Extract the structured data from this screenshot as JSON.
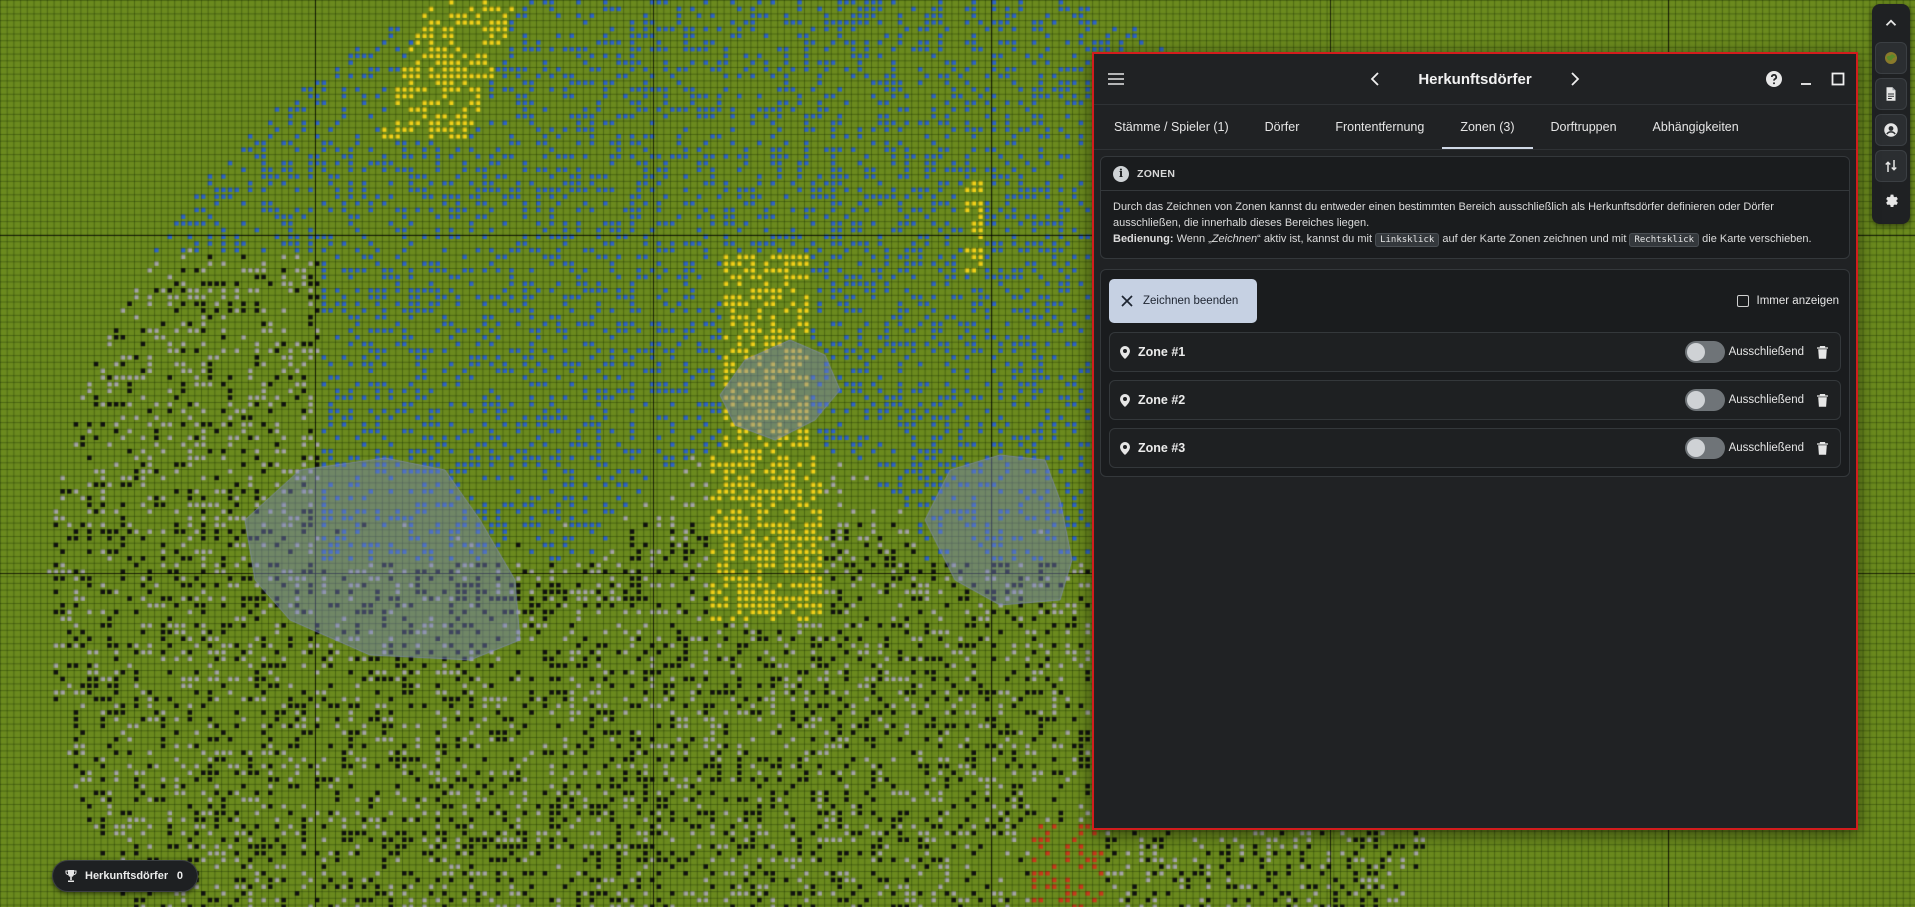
{
  "colors": {
    "map_bg": "#6b8a1e",
    "panel_bg": "#202224",
    "panel_border": "#d21d1d",
    "accent": "#c6d1e3",
    "village_blue": "#2f64c8",
    "village_yellow": "#f2d21a",
    "village_grey": "#a6a6a6",
    "village_black": "#111111",
    "village_red": "#c93a1c"
  },
  "toolbar": {
    "items": [
      {
        "name": "chevron-up-icon"
      },
      {
        "name": "world-map-icon"
      },
      {
        "name": "document-icon"
      },
      {
        "name": "account-icon"
      },
      {
        "name": "route-icon"
      },
      {
        "name": "gear-icon"
      }
    ]
  },
  "panel": {
    "title": "Herkunftsdörfer",
    "tabs": [
      {
        "label": "Stämme / Spieler (1)",
        "active": false
      },
      {
        "label": "Dörfer",
        "active": false
      },
      {
        "label": "Frontentfernung",
        "active": false
      },
      {
        "label": "Zonen (3)",
        "active": true
      },
      {
        "label": "Dorftruppen",
        "active": false
      },
      {
        "label": "Abhängigkeiten",
        "active": false
      }
    ],
    "info": {
      "title": "ZONEN",
      "description": "Durch das Zeichnen von Zonen kannst du entweder einen bestimmten Bereich ausschließlich als Herkunftsdörfer definieren oder Dörfer ausschließen, die innerhalb dieses Bereiches liegen.",
      "usage_label": "Bedienung:",
      "usage_part1": "Wenn „",
      "usage_em": "Zeichnen",
      "usage_part2": "“ aktiv ist, kannst du mit",
      "key_left": "Linksklick",
      "usage_part3": "auf der Karte Zonen zeichnen und mit",
      "key_right": "Rechtsklick",
      "usage_part4": "die Karte verschieben."
    },
    "stop_button": "Zeichnen beenden",
    "always_show": "Immer anzeigen",
    "zones": [
      {
        "name": "Zone #1",
        "exclusive_label": "Ausschließend",
        "exclusive": false
      },
      {
        "name": "Zone #2",
        "exclusive_label": "Ausschließend",
        "exclusive": false
      },
      {
        "name": "Zone #3",
        "exclusive_label": "Ausschließend",
        "exclusive": false
      }
    ]
  },
  "chip": {
    "label": "Herkunftsdörfer",
    "count": "0"
  }
}
